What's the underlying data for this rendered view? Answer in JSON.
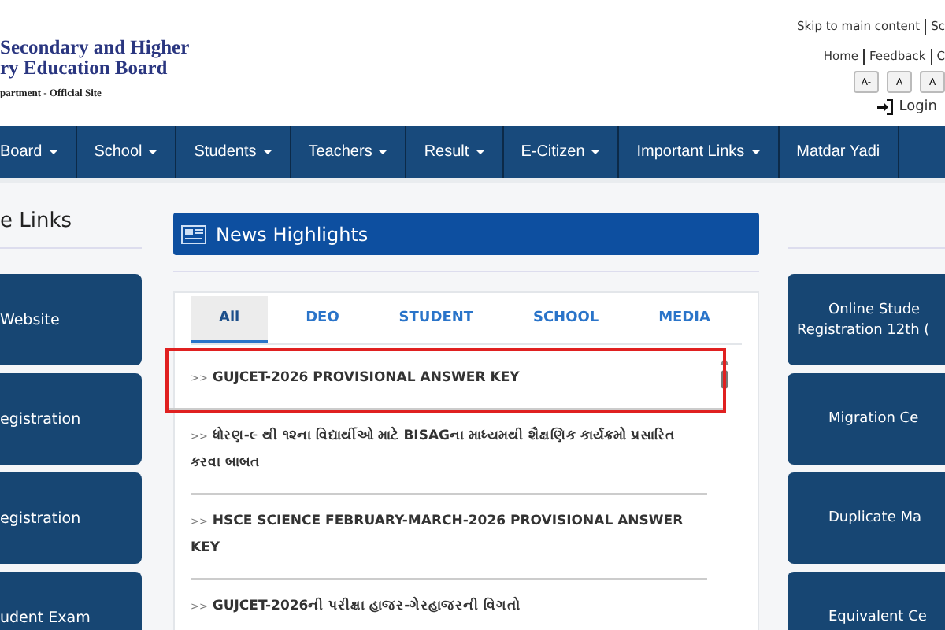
{
  "header": {
    "logo_lines": [
      "Secondary and Higher",
      "ry Education Board"
    ],
    "subtitle": "partment - Official Site",
    "top_links": [
      "Skip to main content",
      "Sc"
    ],
    "links": [
      "Home",
      "Feedback",
      "C"
    ],
    "font_buttons": [
      "A-",
      "A",
      "A"
    ],
    "login": "Login"
  },
  "nav": [
    {
      "label": "Board",
      "dropdown": true
    },
    {
      "label": "School",
      "dropdown": true
    },
    {
      "label": "Students",
      "dropdown": true
    },
    {
      "label": "Teachers",
      "dropdown": true
    },
    {
      "label": "Result",
      "dropdown": true
    },
    {
      "label": "E-Citizen",
      "dropdown": true
    },
    {
      "label": "Important Links",
      "dropdown": true
    },
    {
      "label": "Matdar Yadi",
      "dropdown": false
    }
  ],
  "left_panel": {
    "title": "e Links",
    "buttons": [
      "Website",
      "egistration",
      "egistration",
      "udent Exam"
    ]
  },
  "news": {
    "title": "News Highlights",
    "tabs": [
      {
        "label": "All",
        "selected": true
      },
      {
        "label": "DEO",
        "selected": false
      },
      {
        "label": "STUDENT",
        "selected": false
      },
      {
        "label": "SCHOOL",
        "selected": false
      },
      {
        "label": "MEDIA",
        "selected": false
      }
    ],
    "items": [
      {
        "marker": ">>",
        "text": "GUJCET-2026 PROVISIONAL ANSWER KEY",
        "highlighted": true
      },
      {
        "marker": ">>",
        "text": "ધોરણ-૯ થી ૧૨ના વિદ્યાર્થીઓ માટે BISAGના માધ્યમથી શૈક્ષણિક કાર્યક્રમો પ્રસારિત કરવા બાબત",
        "highlighted": false
      },
      {
        "marker": ">>",
        "text": "HSCE SCIENCE FEBRUARY-MARCH-2026 PROVISIONAL ANSWER KEY",
        "highlighted": false
      },
      {
        "marker": ">>",
        "text": "GUJCET-2026ની પરીક્ષા હાજર-ગેરહાજરની વિગતો",
        "highlighted": false
      }
    ]
  },
  "right_panel": {
    "buttons": [
      [
        "Online Stude",
        "Registration 12th ("
      ],
      [
        "Migration Ce"
      ],
      [
        "Duplicate Ma"
      ],
      [
        "Equivalent Ce"
      ]
    ]
  }
}
